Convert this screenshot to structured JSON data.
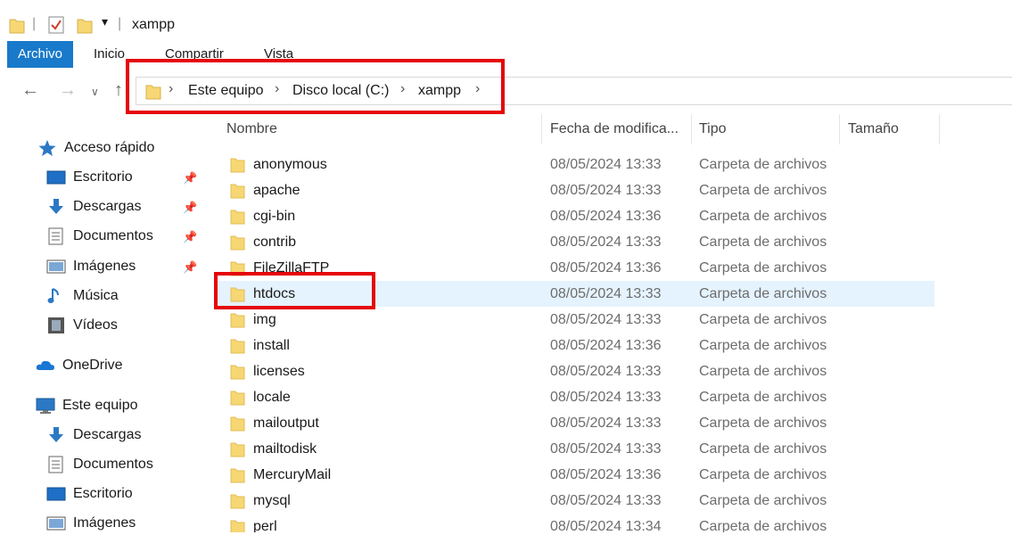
{
  "window": {
    "title": "xampp"
  },
  "ribbon": {
    "tabs": [
      "Archivo",
      "Inicio",
      "Compartir",
      "Vista"
    ]
  },
  "address": {
    "crumbs": [
      "Este equipo",
      "Disco local (C:)",
      "xampp"
    ]
  },
  "sidebar": {
    "items": [
      {
        "label": "Acceso rápido",
        "icon": "star-icon"
      },
      {
        "label": "Escritorio",
        "icon": "desktop-icon",
        "pinned": true
      },
      {
        "label": "Descargas",
        "icon": "download-icon",
        "pinned": true
      },
      {
        "label": "Documentos",
        "icon": "document-icon",
        "pinned": true
      },
      {
        "label": "Imágenes",
        "icon": "pictures-icon",
        "pinned": true
      },
      {
        "label": "Música",
        "icon": "music-icon"
      },
      {
        "label": "Vídeos",
        "icon": "video-icon"
      },
      {
        "label": "OneDrive",
        "icon": "cloud-icon"
      },
      {
        "label": "Este equipo",
        "icon": "computer-icon"
      },
      {
        "label": "Descargas",
        "icon": "download-icon"
      },
      {
        "label": "Documentos",
        "icon": "document-icon"
      },
      {
        "label": "Escritorio",
        "icon": "desktop-icon"
      },
      {
        "label": "Imágenes",
        "icon": "pictures-icon"
      }
    ]
  },
  "columns": [
    "Nombre",
    "Fecha de modifica...",
    "Tipo",
    "Tamaño"
  ],
  "files": [
    {
      "name": "anonymous",
      "date": "08/05/2024 13:33",
      "type": "Carpeta de archivos"
    },
    {
      "name": "apache",
      "date": "08/05/2024 13:33",
      "type": "Carpeta de archivos"
    },
    {
      "name": "cgi-bin",
      "date": "08/05/2024 13:36",
      "type": "Carpeta de archivos"
    },
    {
      "name": "contrib",
      "date": "08/05/2024 13:33",
      "type": "Carpeta de archivos"
    },
    {
      "name": "FileZillaFTP",
      "date": "08/05/2024 13:36",
      "type": "Carpeta de archivos"
    },
    {
      "name": "htdocs",
      "date": "08/05/2024 13:33",
      "type": "Carpeta de archivos",
      "selected": true
    },
    {
      "name": "img",
      "date": "08/05/2024 13:33",
      "type": "Carpeta de archivos"
    },
    {
      "name": "install",
      "date": "08/05/2024 13:36",
      "type": "Carpeta de archivos"
    },
    {
      "name": "licenses",
      "date": "08/05/2024 13:33",
      "type": "Carpeta de archivos"
    },
    {
      "name": "locale",
      "date": "08/05/2024 13:33",
      "type": "Carpeta de archivos"
    },
    {
      "name": "mailoutput",
      "date": "08/05/2024 13:33",
      "type": "Carpeta de archivos"
    },
    {
      "name": "mailtodisk",
      "date": "08/05/2024 13:33",
      "type": "Carpeta de archivos"
    },
    {
      "name": "MercuryMail",
      "date": "08/05/2024 13:36",
      "type": "Carpeta de archivos"
    },
    {
      "name": "mysql",
      "date": "08/05/2024 13:33",
      "type": "Carpeta de archivos"
    },
    {
      "name": "perl",
      "date": "08/05/2024 13:34",
      "type": "Carpeta de archivos"
    }
  ],
  "colors": {
    "accent": "#1979ca",
    "highlight": "#e5050a",
    "selection": "#e5f3ff",
    "folder": "#f7d774"
  }
}
